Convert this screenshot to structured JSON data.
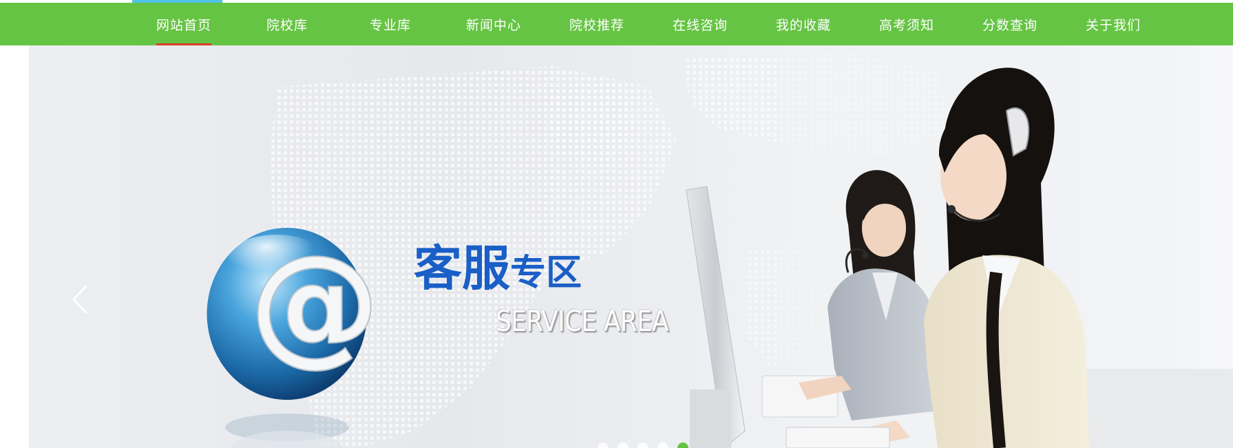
{
  "nav": {
    "items": [
      {
        "label": "网站首页",
        "active": true
      },
      {
        "label": "院校库"
      },
      {
        "label": "专业库"
      },
      {
        "label": "新闻中心"
      },
      {
        "label": "院校推荐"
      },
      {
        "label": "在线咨询"
      },
      {
        "label": "我的收藏"
      },
      {
        "label": "高考须知"
      },
      {
        "label": "分数查询"
      },
      {
        "label": "关于我们"
      }
    ]
  },
  "banner": {
    "title_big": "客服",
    "title_small": "专区",
    "subtitle": "SERVICE AREA",
    "at_symbol": "@",
    "slide_count": 5,
    "active_slide": 5
  },
  "colors": {
    "nav_bg": "#66c444",
    "nav_active_underline": "#d7402a",
    "top_accent": "#4fc3e8",
    "title_blue": "#1a5fc7"
  },
  "icons": {
    "prev": "chevron-left-icon"
  }
}
